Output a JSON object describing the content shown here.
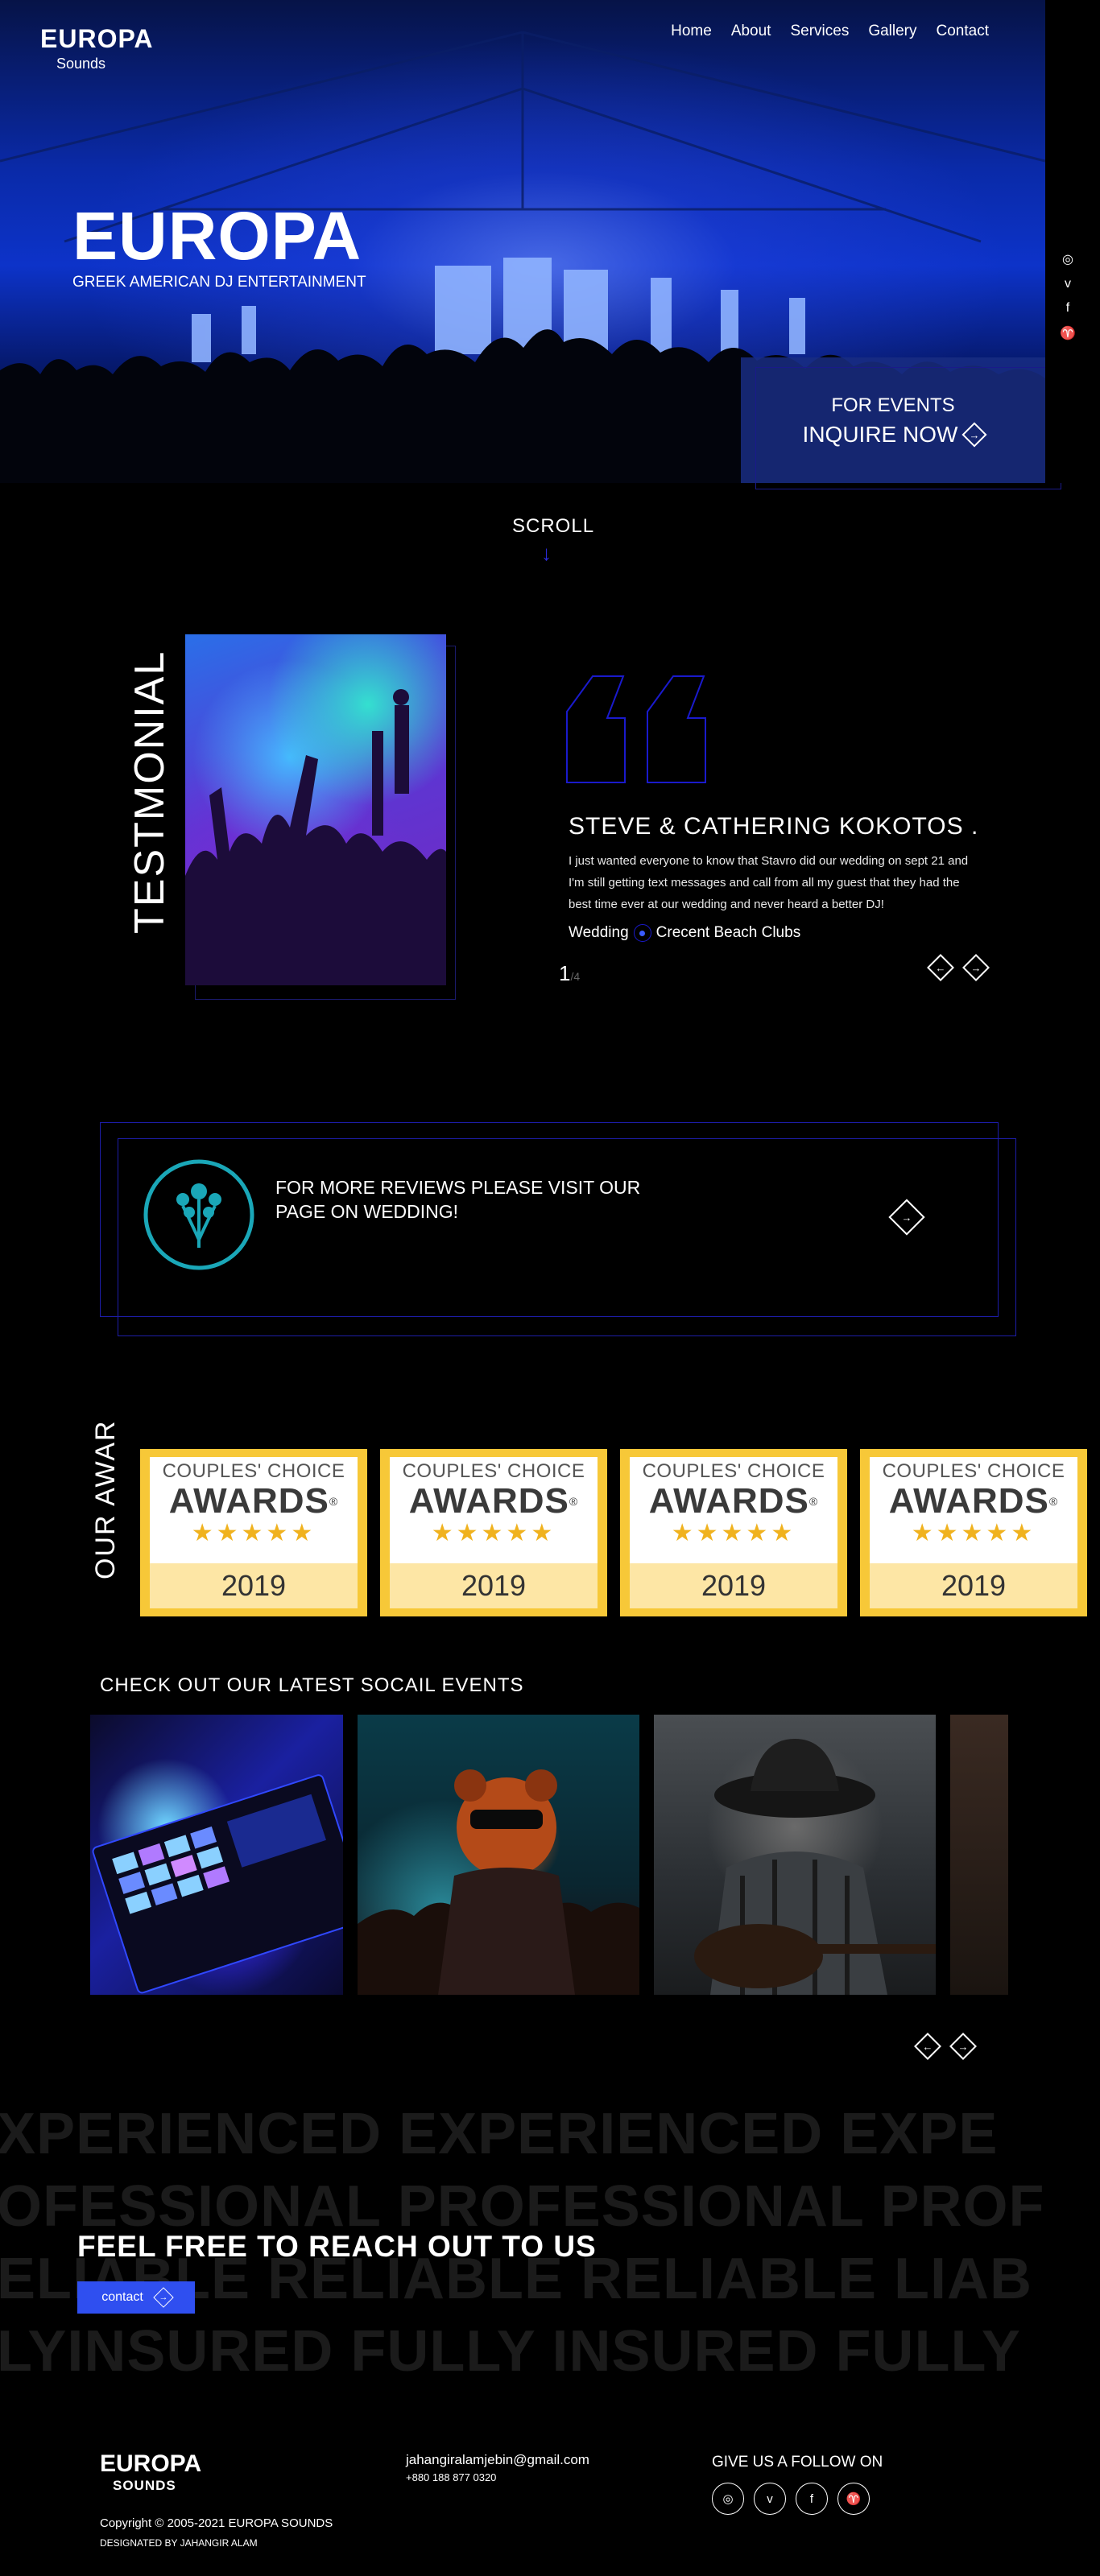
{
  "header": {
    "brand_name": "EUROPA",
    "brand_sub": "Sounds",
    "nav": [
      "Home",
      "About",
      "Services",
      "Gallery",
      "Contact"
    ]
  },
  "hero": {
    "title": "EUROPA",
    "subtitle": "GREEK AMERICAN DJ ENTERTAINMENT",
    "inquire_small": "FOR EVENTS",
    "inquire_big": "INQUIRE NOW"
  },
  "social_side": [
    "instagram-icon",
    "vimeo-icon",
    "facebook-icon",
    "twitter-icon"
  ],
  "scroll": {
    "label": "SCROLL"
  },
  "testimonial": {
    "section_label": "TESTMONIAL",
    "name": "STEVE & CATHERING KOKOTOS .",
    "text": "I just wanted everyone to know that Stavro did our wedding on sept 21 and I'm still getting text messages and call from all my guest that they had the best time ever at our wedding and never heard a better DJ!",
    "event_type": "Wedding",
    "venue": "Crecent Beach Clubs",
    "page_current": "1",
    "page_total": "/4"
  },
  "reviews": {
    "text": "FOR MORE REVIEWS PLEASE VISIT OUR PAGE ON WEDDING!"
  },
  "awards": {
    "section_label": "OUR AWAR",
    "items": [
      {
        "line1": "COUPLES' CHOICE",
        "line2": "AWARDS",
        "stars": "★★★★★",
        "year": "2019"
      },
      {
        "line1": "COUPLES' CHOICE",
        "line2": "AWARDS",
        "stars": "★★★★★",
        "year": "2019"
      },
      {
        "line1": "COUPLES' CHOICE",
        "line2": "AWARDS",
        "stars": "★★★★★",
        "year": "2019"
      },
      {
        "line1": "COUPLES' CHOICE",
        "line2": "AWARDS",
        "stars": "★★★★★",
        "year": "2019"
      }
    ]
  },
  "events": {
    "title": "CHECK OUT OUR LATEST SOCAIL EVENTS"
  },
  "contact": {
    "bg_rows": [
      "XPERIENCED   EXPERIENCED   EXPE",
      "OFESSIONAL PROFESSIONAL PROF",
      "ELIABLE   RELIABLE     RELIABLE     LIAB",
      "LYINSURED    FULLY INSURED  FULLY"
    ],
    "title": "FEEL FREE TO REACH OUT TO US",
    "button_label": "contact"
  },
  "footer": {
    "brand_name": "EUROPA",
    "brand_sub": "SOUNDS",
    "copyright": "Copyright © 2005-2021 EUROPA SOUNDS",
    "designer": "DESIGNATED BY JAHANGIR ALAM",
    "email": "jahangiralamjebin@gmail.com",
    "phone": "+880 188 877 0320",
    "follow_label": "GIVE US A FOLLOW ON"
  },
  "colors": {
    "accent": "#2f4ff0",
    "outline": "#1d1da8",
    "award_gold": "#f7c838"
  }
}
